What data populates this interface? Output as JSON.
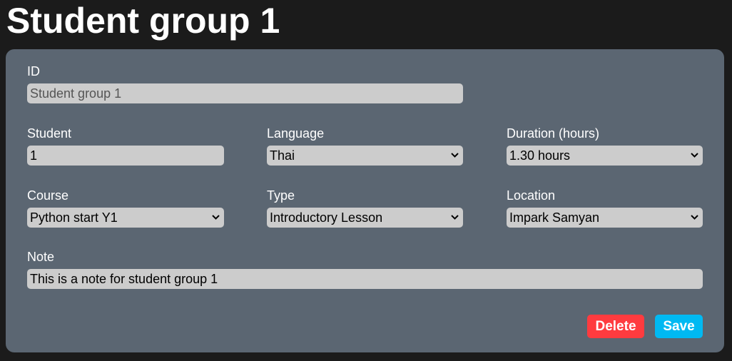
{
  "title": "Student group 1",
  "fields": {
    "id": {
      "label": "ID",
      "value": "Student group 1"
    },
    "student": {
      "label": "Student",
      "value": "1"
    },
    "language": {
      "label": "Language",
      "value": "Thai"
    },
    "duration": {
      "label": "Duration (hours)",
      "value": "1.30 hours"
    },
    "course": {
      "label": "Course",
      "value": "Python start Y1"
    },
    "type": {
      "label": "Type",
      "value": "Introductory Lesson"
    },
    "location": {
      "label": "Location",
      "value": "Impark Samyan"
    },
    "note": {
      "label": "Note",
      "value": "This is a note for student group 1"
    }
  },
  "buttons": {
    "delete": "Delete",
    "save": "Save"
  },
  "colors": {
    "delete": "#ff3b3f",
    "save": "#00b9f2",
    "card": "#5b6672"
  }
}
